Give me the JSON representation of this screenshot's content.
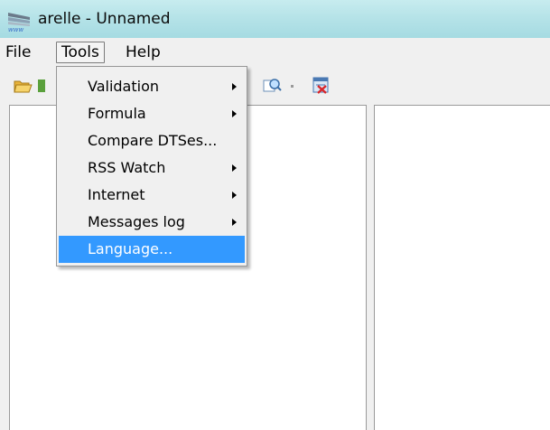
{
  "window": {
    "title": "arelle - Unnamed"
  },
  "menubar": {
    "items": [
      "File",
      "Tools",
      "Help"
    ]
  },
  "tools_menu": {
    "items": [
      {
        "label": "Validation",
        "submenu": true
      },
      {
        "label": "Formula",
        "submenu": true
      },
      {
        "label": "Compare DTSes...",
        "submenu": false
      },
      {
        "label": "RSS Watch",
        "submenu": true
      },
      {
        "label": "Internet",
        "submenu": true
      },
      {
        "label": "Messages log",
        "submenu": true
      },
      {
        "label": "Language...",
        "submenu": false,
        "selected": true
      }
    ]
  },
  "toolbar": {
    "icons": [
      "open-folder-icon",
      "new-icon",
      "find-icon",
      "close-view-icon"
    ]
  },
  "colors": {
    "titlebar": "#b6e3e8",
    "selection": "#3399ff",
    "menu_bg": "#f0f0f0"
  }
}
